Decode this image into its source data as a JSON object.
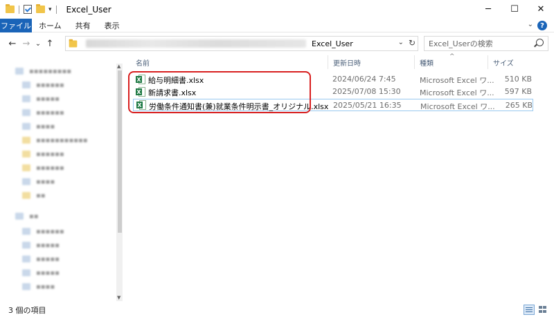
{
  "window": {
    "title": "Excel_User",
    "controls": {
      "minimize": "─",
      "maximize": "☐",
      "close": "✕"
    }
  },
  "ribbon": {
    "tabs": [
      {
        "label": "ファイル",
        "active": true
      },
      {
        "label": "ホーム"
      },
      {
        "label": "共有"
      },
      {
        "label": "表示"
      }
    ],
    "expand_glyph": "⌄",
    "help_glyph": "?"
  },
  "navigation": {
    "back_glyph": "←",
    "forward_glyph": "→",
    "recent_glyph": "⌄",
    "up_glyph": "↑",
    "address": {
      "current_folder": "Excel_User",
      "dropdown_glyph": "⌄",
      "refresh_glyph": "↻"
    },
    "search": {
      "placeholder": "Excel_Userの検索"
    }
  },
  "columns": [
    {
      "label": "名前"
    },
    {
      "label": "更新日時"
    },
    {
      "label": "種類"
    },
    {
      "label": "サイズ"
    }
  ],
  "files": [
    {
      "name": "給与明細書.xlsx",
      "modified": "2024/06/24 7:45",
      "type": "Microsoft Excel ワ...",
      "size": "510 KB",
      "icon": "excel-file-icon"
    },
    {
      "name": "新請求書.xlsx",
      "modified": "2025/07/08 15:30",
      "type": "Microsoft Excel ワ...",
      "size": "597 KB",
      "icon": "excel-file-icon"
    },
    {
      "name": "労働条件通知書(兼)就業条件明示書_オリジナル.xlsx",
      "modified": "2025/05/21 16:35",
      "type": "Microsoft Excel ワ...",
      "size": "265 KB",
      "icon": "excel-file-icon",
      "selected": true
    }
  ],
  "status": {
    "item_count": "3 個の項目"
  },
  "colors": {
    "accent": "#1a64b8",
    "highlight_box": "#d81e1e",
    "selection_border": "#99c9ef",
    "excel_green": "#1f7a44"
  }
}
